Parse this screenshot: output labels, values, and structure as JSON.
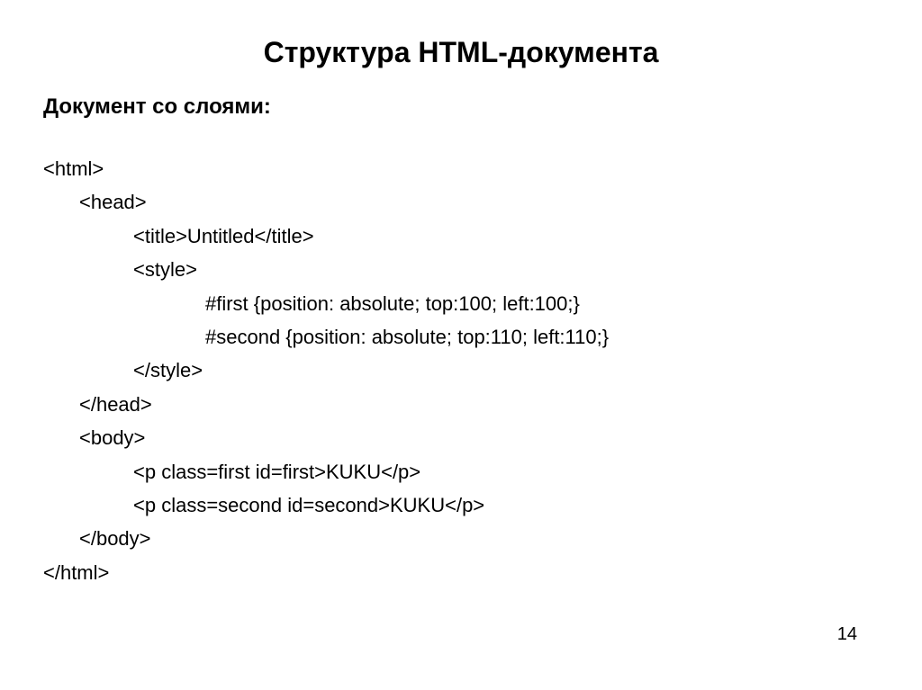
{
  "title": "Структура HTML-документа",
  "subtitle": "Документ со слоями:",
  "code": {
    "l0": "<html>",
    "l1": "<head>",
    "l2": "<title>Untitled</title>",
    "l3": "<style>",
    "l4": "#first {position: absolute; top:100; left:100;}",
    "l5": "#second {position: absolute; top:110; left:110;}",
    "l6": "</style>",
    "l7": "</head>",
    "l8": "<body>",
    "l9": "<p class=first id=first>KUKU</p>",
    "l10": "<p class=second id=second>KUKU</p>",
    "l11": "</body>",
    "l12": "</html>"
  },
  "page_number": "14"
}
